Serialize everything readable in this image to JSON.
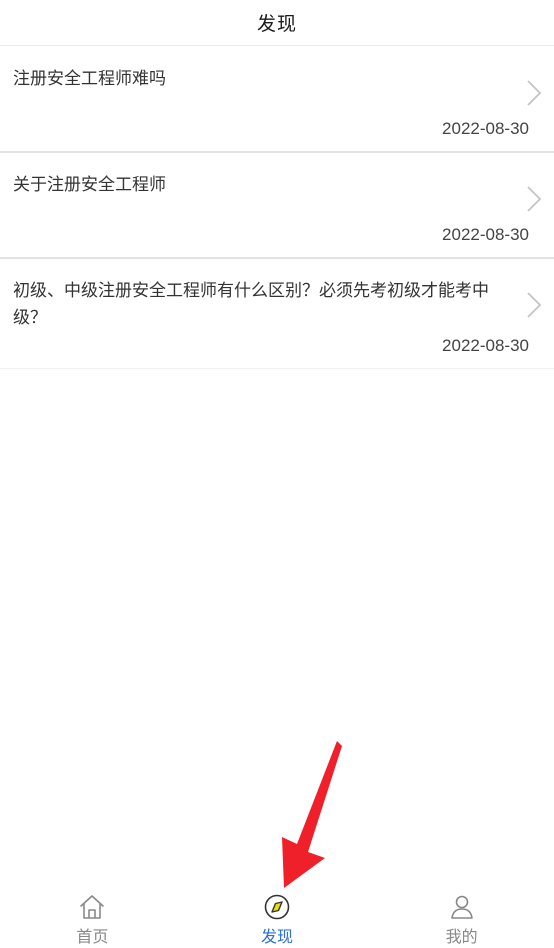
{
  "header": {
    "title": "发现"
  },
  "articles": [
    {
      "title": "注册安全工程师难吗",
      "date": "2022-08-30"
    },
    {
      "title": "关于注册安全工程师",
      "date": "2022-08-30"
    },
    {
      "title": "初级、中级注册安全工程师有什么区别？必须先考初级才能考中级？",
      "date": "2022-08-30"
    }
  ],
  "tabbar": {
    "tabs": [
      {
        "label": "首页",
        "icon": "home-icon",
        "active": false
      },
      {
        "label": "发现",
        "icon": "compass-icon",
        "active": true
      },
      {
        "label": "我的",
        "icon": "user-icon",
        "active": false
      }
    ]
  },
  "colors": {
    "active": "#2c6fd9",
    "inactive": "#888888",
    "annotation_arrow": "#f0202a"
  }
}
